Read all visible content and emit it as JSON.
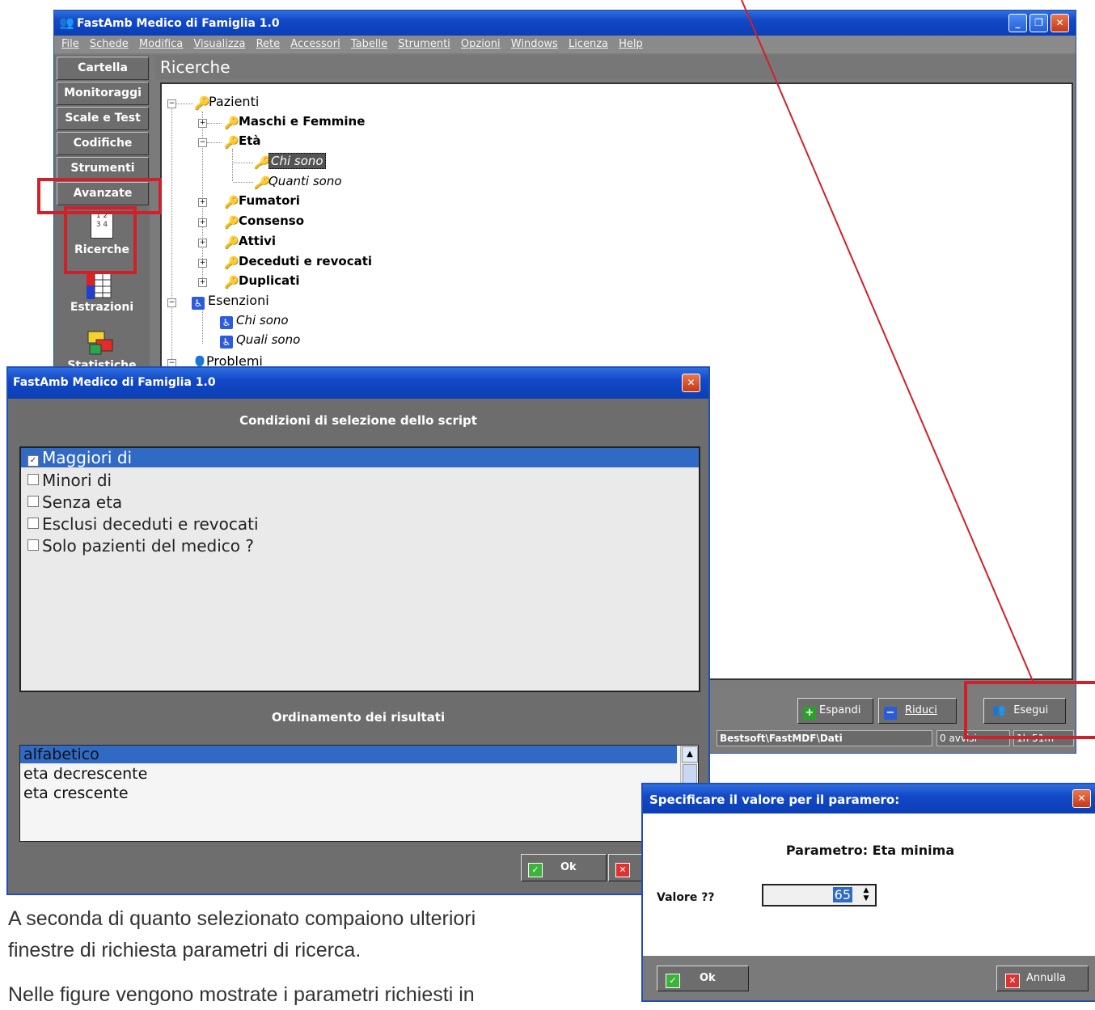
{
  "main_window": {
    "title": "FastAmb Medico di Famiglia 1.0",
    "menu": [
      "File",
      "Schede",
      "Modifica",
      "Visualizza",
      "Rete",
      "Accessori",
      "Tabelle",
      "Strumenti",
      "Opzioni",
      "Windows",
      "Licenza",
      "Help"
    ],
    "sidebar": {
      "buttons": [
        "Cartella",
        "Monitoraggi",
        "Scale e Test",
        "Codifiche",
        "Strumenti",
        "Avanzate"
      ],
      "icons": [
        {
          "label": "Ricerche",
          "icon": "numbers-grid-icon"
        },
        {
          "label": "Estrazioni",
          "icon": "table-extract-icon"
        },
        {
          "label": "Statistiche",
          "icon": "cubes-stats-icon"
        }
      ]
    },
    "panel_title": "Ricerche",
    "tree": {
      "pazienti": "Pazienti",
      "maschi_femmine": "Maschi e Femmine",
      "eta": "Età",
      "chi_sono": "Chi sono",
      "quanti_sono": "Quanti sono",
      "fumatori": "Fumatori",
      "consenso": "Consenso",
      "attivi": "Attivi",
      "deceduti": "Deceduti e revocati",
      "duplicati": "Duplicati",
      "esenzioni": "Esenzioni",
      "es_chi_sono": "Chi sono",
      "es_quali_sono": "Quali sono",
      "problemi": "Problemi"
    },
    "toolbar": {
      "espandi": "Espandi",
      "riduci": "Riduci",
      "esegui": "Esegui"
    },
    "status": {
      "path": "Bestsoft\\FastMDF\\Dati",
      "avvisi": "0 avvisi",
      "time": "1h 51m"
    }
  },
  "script_dialog": {
    "title": "FastAmb Medico di Famiglia 1.0",
    "conditions_header": "Condizioni di selezione dello script",
    "conditions": [
      {
        "label": "Maggiori di",
        "checked": true,
        "selected": true
      },
      {
        "label": "Minori di",
        "checked": false,
        "selected": false
      },
      {
        "label": "Senza eta",
        "checked": false,
        "selected": false
      },
      {
        "label": "Esclusi deceduti e revocati",
        "checked": false,
        "selected": false
      },
      {
        "label": "Solo pazienti del medico ?",
        "checked": false,
        "selected": false
      }
    ],
    "order_header": "Ordinamento dei risultati",
    "order_options": [
      "alfabetico",
      "eta decrescente",
      "eta crescente"
    ],
    "order_selected": "alfabetico",
    "ok_label": "Ok"
  },
  "param_dialog": {
    "title": "Specificare il valore per il paramero:",
    "param_label": "Parametro: Eta minima",
    "value_label": "Valore ??",
    "value": "65",
    "ok_label": "Ok",
    "cancel_label": "Annulla"
  },
  "caption": {
    "line1": "A seconda di quanto selezionato compaiono ulteriori",
    "line2": "finestre di richiesta parametri di ricerca.",
    "line3": "Nelle figure vengono mostrate i parametri richiesti in"
  },
  "colors": {
    "highlight": "#d0202a",
    "selection": "#316ac5",
    "titlebar": "#1348c7"
  }
}
